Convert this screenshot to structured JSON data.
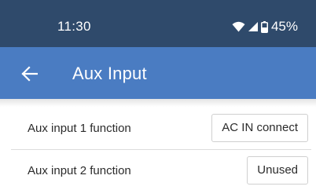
{
  "status_bar": {
    "time": "11:30",
    "battery_percent": "45%",
    "icons": [
      "wifi-icon",
      "cellular-signal-icon",
      "battery-icon"
    ]
  },
  "app_bar": {
    "title": "Aux Input",
    "back_icon": "arrow-left-icon"
  },
  "settings": [
    {
      "label": "Aux input 1 function",
      "value": "AC IN connect"
    },
    {
      "label": "Aux input 2 function",
      "value": "Unused"
    }
  ],
  "colors": {
    "status_bar": "#2f4a6b",
    "app_bar": "#4a7cc2",
    "text": "#2b2b2b"
  }
}
